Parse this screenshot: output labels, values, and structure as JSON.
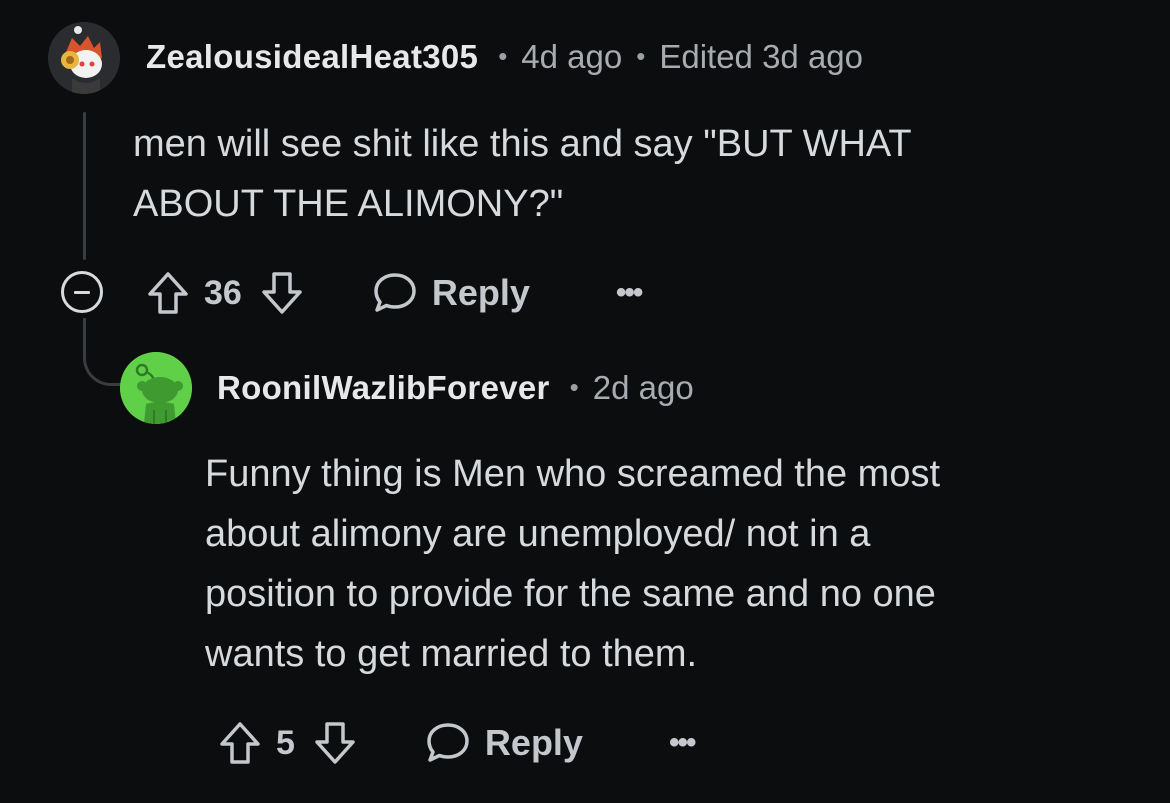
{
  "comment1": {
    "username": "ZealousidealHeat305",
    "age": "4d ago",
    "edited": "Edited 3d ago",
    "body_line1": "men will see shit like this and say \"BUT WHAT",
    "body_line2": "ABOUT THE ALIMONY?\"",
    "score": "36",
    "reply_label": "Reply",
    "more_label": "•••"
  },
  "comment2": {
    "username": "RoonilWazlibForever",
    "age": "2d ago",
    "body_line1": "Funny thing is Men who screamed the most",
    "body_line2": "about alimony are unemployed/ not in a",
    "body_line3": "position to provide for the same and no one",
    "body_line4": "wants to get married to them.",
    "score": "5",
    "reply_label": "Reply",
    "more_label": "•••"
  },
  "separator": "•",
  "icons": {
    "upvote": "arrow-up-icon",
    "downvote": "arrow-down-icon",
    "reply": "speech-bubble-icon",
    "collapse": "minus-circle-icon"
  },
  "colors": {
    "background": "#0c0d0f",
    "text": "#d7dadc",
    "muted": "#a8acb0",
    "avatar2": "#5fd048"
  }
}
